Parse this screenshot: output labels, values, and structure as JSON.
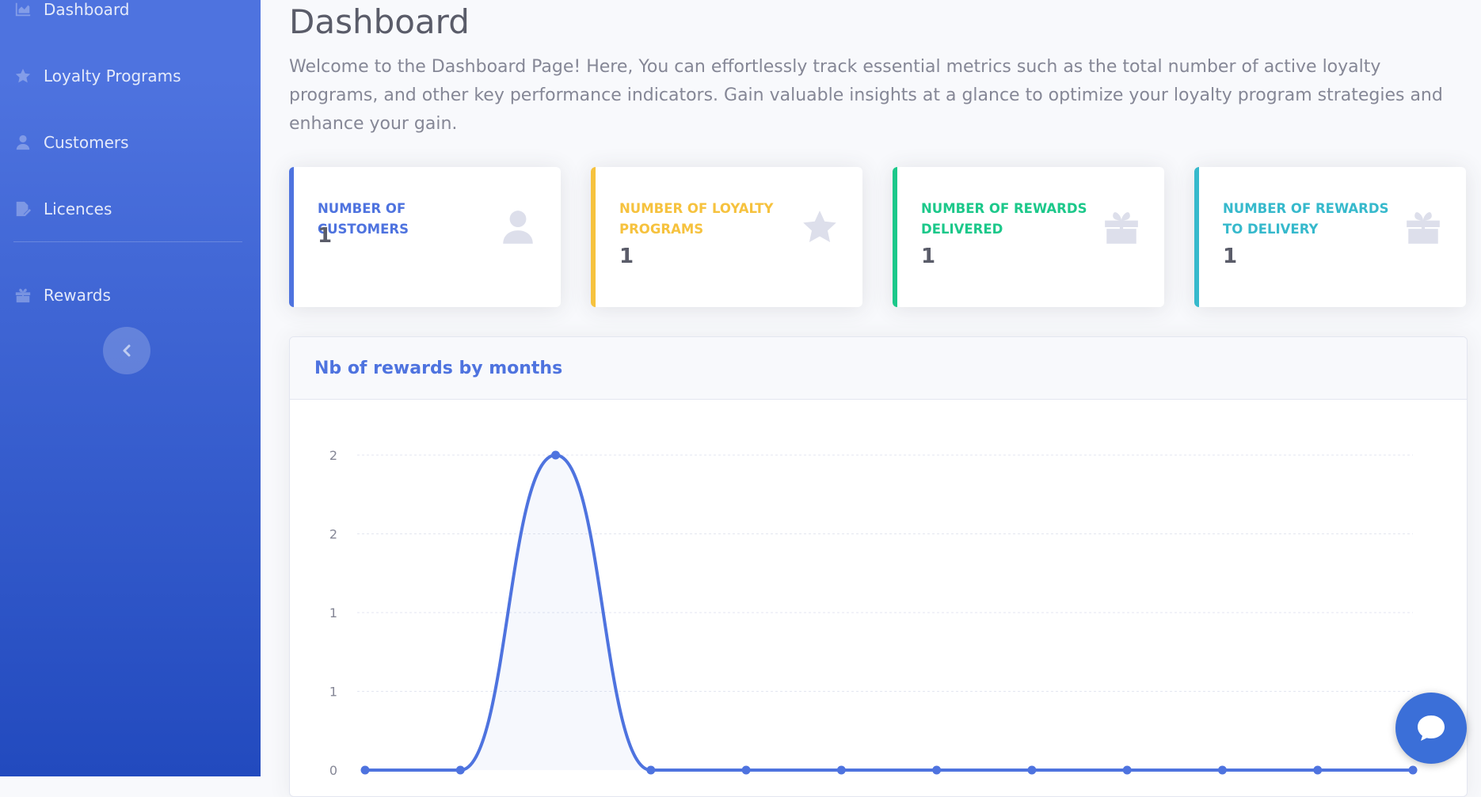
{
  "sidebar": {
    "items": [
      {
        "label": "Dashboard",
        "icon": "chart-area-icon"
      },
      {
        "label": "Loyalty Programs",
        "icon": "star-icon"
      },
      {
        "label": "Customers",
        "icon": "user-icon"
      },
      {
        "label": "Licences",
        "icon": "file-signature-icon"
      },
      {
        "label": "Rewards",
        "icon": "gift-icon"
      }
    ],
    "toggle_icon": "chevron-left-icon"
  },
  "main": {
    "title": "Dashboard",
    "intro": "Welcome to the Dashboard Page! Here, You can effortlessly track essential metrics such as the total number of active loyalty programs, and other key performance indicators. Gain valuable insights at a glance to optimize your loyalty program strategies and enhance your gain."
  },
  "cards": [
    {
      "label": "NUMBER OF CUSTOMERS",
      "value": "1",
      "color": "#4e73df",
      "icon": "user-icon"
    },
    {
      "label": "NUMBER OF LOYALTY PROGRAMS",
      "value": "1",
      "color": "#f6c23e",
      "icon": "star-icon"
    },
    {
      "label": "NUMBER OF REWARDS DELIVERED",
      "value": "1",
      "color": "#1cc88a",
      "icon": "gift-icon"
    },
    {
      "label": "NUMBER OF REWARDS TO DELIVERY",
      "value": "1",
      "color": "#36b9cc",
      "icon": "gift-icon"
    }
  ],
  "chart_card": {
    "title": "Nb of rewards by months"
  },
  "chart_data": {
    "type": "line",
    "title": "Nb of rewards by months",
    "ytick_labels": [
      "0",
      "1",
      "1",
      "2",
      "2"
    ],
    "yticks": [
      0,
      0.5,
      1,
      1.5,
      2
    ],
    "ylim": [
      0,
      2
    ],
    "values": [
      0,
      0,
      2,
      0,
      0,
      0,
      0,
      0,
      0,
      0,
      0,
      0
    ],
    "line_color": "#4e73df",
    "fill": true,
    "grid": true
  },
  "chat_button": {
    "icon": "chat-bubble-icon"
  }
}
